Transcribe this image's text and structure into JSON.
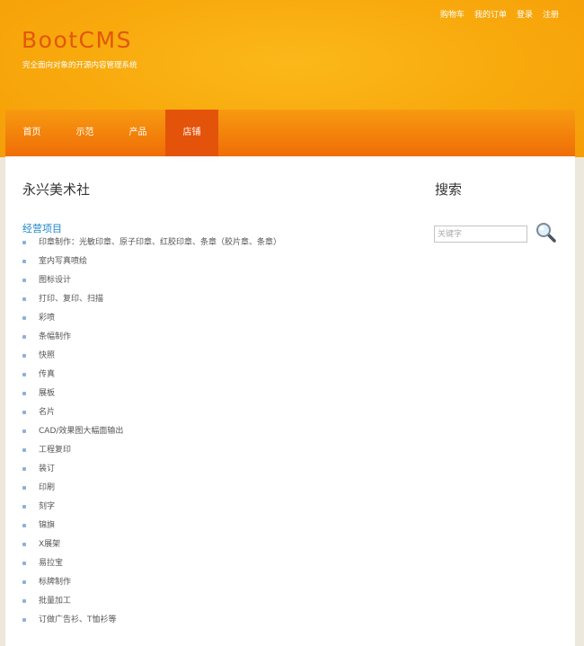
{
  "top_links": [
    "购物车",
    "我的订单",
    "登录",
    "注册"
  ],
  "logo": "BootCMS",
  "slogan": "完全面向对象的开源内容管理系统",
  "nav": [
    {
      "label": "首页",
      "active": false
    },
    {
      "label": "示范",
      "active": false
    },
    {
      "label": "产品",
      "active": false
    },
    {
      "label": "店铺",
      "active": true
    }
  ],
  "main": {
    "title": "永兴美术社",
    "section_title": "经营项目",
    "items": [
      "印章制作：光敏印章、原子印章、红胶印章、条章（胶片章、条章）",
      "室内写真喷绘",
      "图标设计",
      "打印、复印、扫描",
      "彩喷",
      "条幅制作",
      "快照",
      "传真",
      "展板",
      "名片",
      "CAD/效果图大幅面输出",
      "工程复印",
      "装订",
      "印刷",
      "刻字",
      "锦旗",
      "X展架",
      "易拉宝",
      "标牌制作",
      "批量加工",
      "订做广告衫、T恤衫等"
    ]
  },
  "sidebar": {
    "search_title": "搜索",
    "search_placeholder": "关键字"
  },
  "colors": {
    "header_orange": "#f8a90c",
    "logo": "#e0580a",
    "nav_active": "#e4530a",
    "link_blue": "#1e87c8"
  }
}
